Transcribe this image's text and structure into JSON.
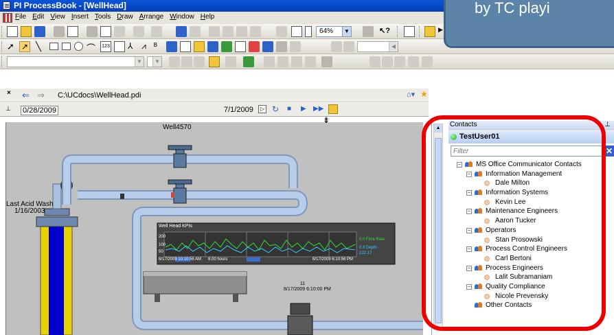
{
  "window": {
    "title": "PI ProcessBook - [WellHead]"
  },
  "menu": [
    "File",
    "Edit",
    "View",
    "Insert",
    "Tools",
    "Draw",
    "Arrange",
    "Window",
    "Help"
  ],
  "toolbar": {
    "zoom": "64%"
  },
  "address": {
    "path": "C:\\UCdocs\\WellHead.pdi"
  },
  "timebar": {
    "start": "0/28/2009",
    "end": "7/1/2009"
  },
  "display": {
    "well_title": "Well4570",
    "acid_wash_label": "Last Acid Wash",
    "acid_wash_date": "1/16/2003",
    "trend_title": "Well Head KPIs",
    "trend_start": "8/17/2009 10:10:56 AM",
    "trend_hours": "8.00 hours",
    "trend_end": "8/17/2009 6:10:56 PM",
    "trend_axis": [
      "200",
      "100",
      "50"
    ],
    "trend_legend": [
      "0.0 Flow Rate",
      "0.0 Depth",
      "122.17"
    ],
    "meter_value": "11",
    "meter_time": "8/17/2009 6:10:00 PM"
  },
  "contacts": {
    "header": "Contacts",
    "user": "TestUser01",
    "filter_placeholder": "Filter",
    "root": "MS Office Communicator Contacts",
    "groups": [
      {
        "name": "Information Management",
        "members": [
          "Dale Milton"
        ]
      },
      {
        "name": "Information Systems",
        "members": [
          "Kevin Lee"
        ]
      },
      {
        "name": "Maintenance Engineers",
        "members": [
          "Aaron Tucker"
        ]
      },
      {
        "name": "Operators",
        "members": [
          "Stan Prosowski"
        ]
      },
      {
        "name": "Process Control Engineers",
        "members": [
          "Carl Bertoni"
        ]
      },
      {
        "name": "Process Engineers",
        "members": [
          "Lalit Subramaniam"
        ]
      },
      {
        "name": "Quality Compliance",
        "members": [
          "Nicole Prevensky"
        ]
      }
    ],
    "other": "Other Contacts"
  },
  "callout": {
    "text": "by TC playi"
  },
  "colors": {
    "title_bar": "#0a54d8",
    "annotation": "#e00000",
    "pipe": "#a9c1e0",
    "trend_line_1": "#33dd33",
    "trend_line_2": "#33ccff"
  }
}
